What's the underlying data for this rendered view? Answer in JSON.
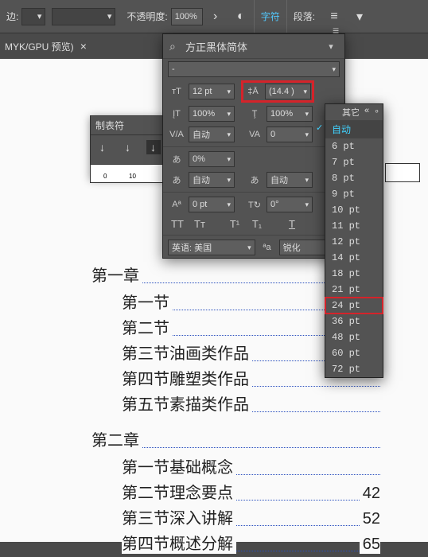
{
  "toolbar": {
    "stroke_label": "边:",
    "opacity_label": "不透明度:",
    "opacity_value": "100%",
    "char_tab": "字符",
    "para_tab": "段落:"
  },
  "doc_tab": {
    "label": "MYK/GPU 预览)"
  },
  "tabs_panel": {
    "title": "制表符"
  },
  "ruler_marks": [
    "0",
    "10"
  ],
  "toc": {
    "chapters": [
      {
        "label": "第一章",
        "sections": [
          {
            "label": "第一节",
            "page": ""
          },
          {
            "label": "第二节",
            "page": ""
          },
          {
            "label": "第三节油画类作品",
            "page": ""
          },
          {
            "label": "第四节雕塑类作品",
            "page": ""
          },
          {
            "label": "第五节素描类作品",
            "page": ""
          }
        ]
      },
      {
        "label": "第二章",
        "sections": [
          {
            "label": "第一节基础概念",
            "page": ""
          },
          {
            "label": "第二节理念要点",
            "page": "42"
          },
          {
            "label": "第三节深入讲解",
            "page": "52"
          },
          {
            "label": "第四节概述分解",
            "page": "65"
          }
        ]
      }
    ]
  },
  "char_panel": {
    "font_family": "方正黑体简体",
    "font_style": "-",
    "size": "12 pt",
    "leading": "(14.4 )",
    "scale_h": "100%",
    "scale_v": "100%",
    "kerning": "自动",
    "tracking": "0",
    "a1": "0%",
    "b1": "自动",
    "b2": "自动",
    "baseline": "0 pt",
    "rotate": "0°",
    "lang": "英语: 美国",
    "aa": "锐化"
  },
  "leading_popup": {
    "header": "其它",
    "auto_label": "自动",
    "items": [
      "6 pt",
      "7 pt",
      "8 pt",
      "9 pt",
      "10 pt",
      "11 pt",
      "12 pt",
      "14 pt",
      "18 pt",
      "21 pt",
      "24 pt",
      "36 pt",
      "48 pt",
      "60 pt",
      "72 pt"
    ],
    "highlight_index": 10
  }
}
